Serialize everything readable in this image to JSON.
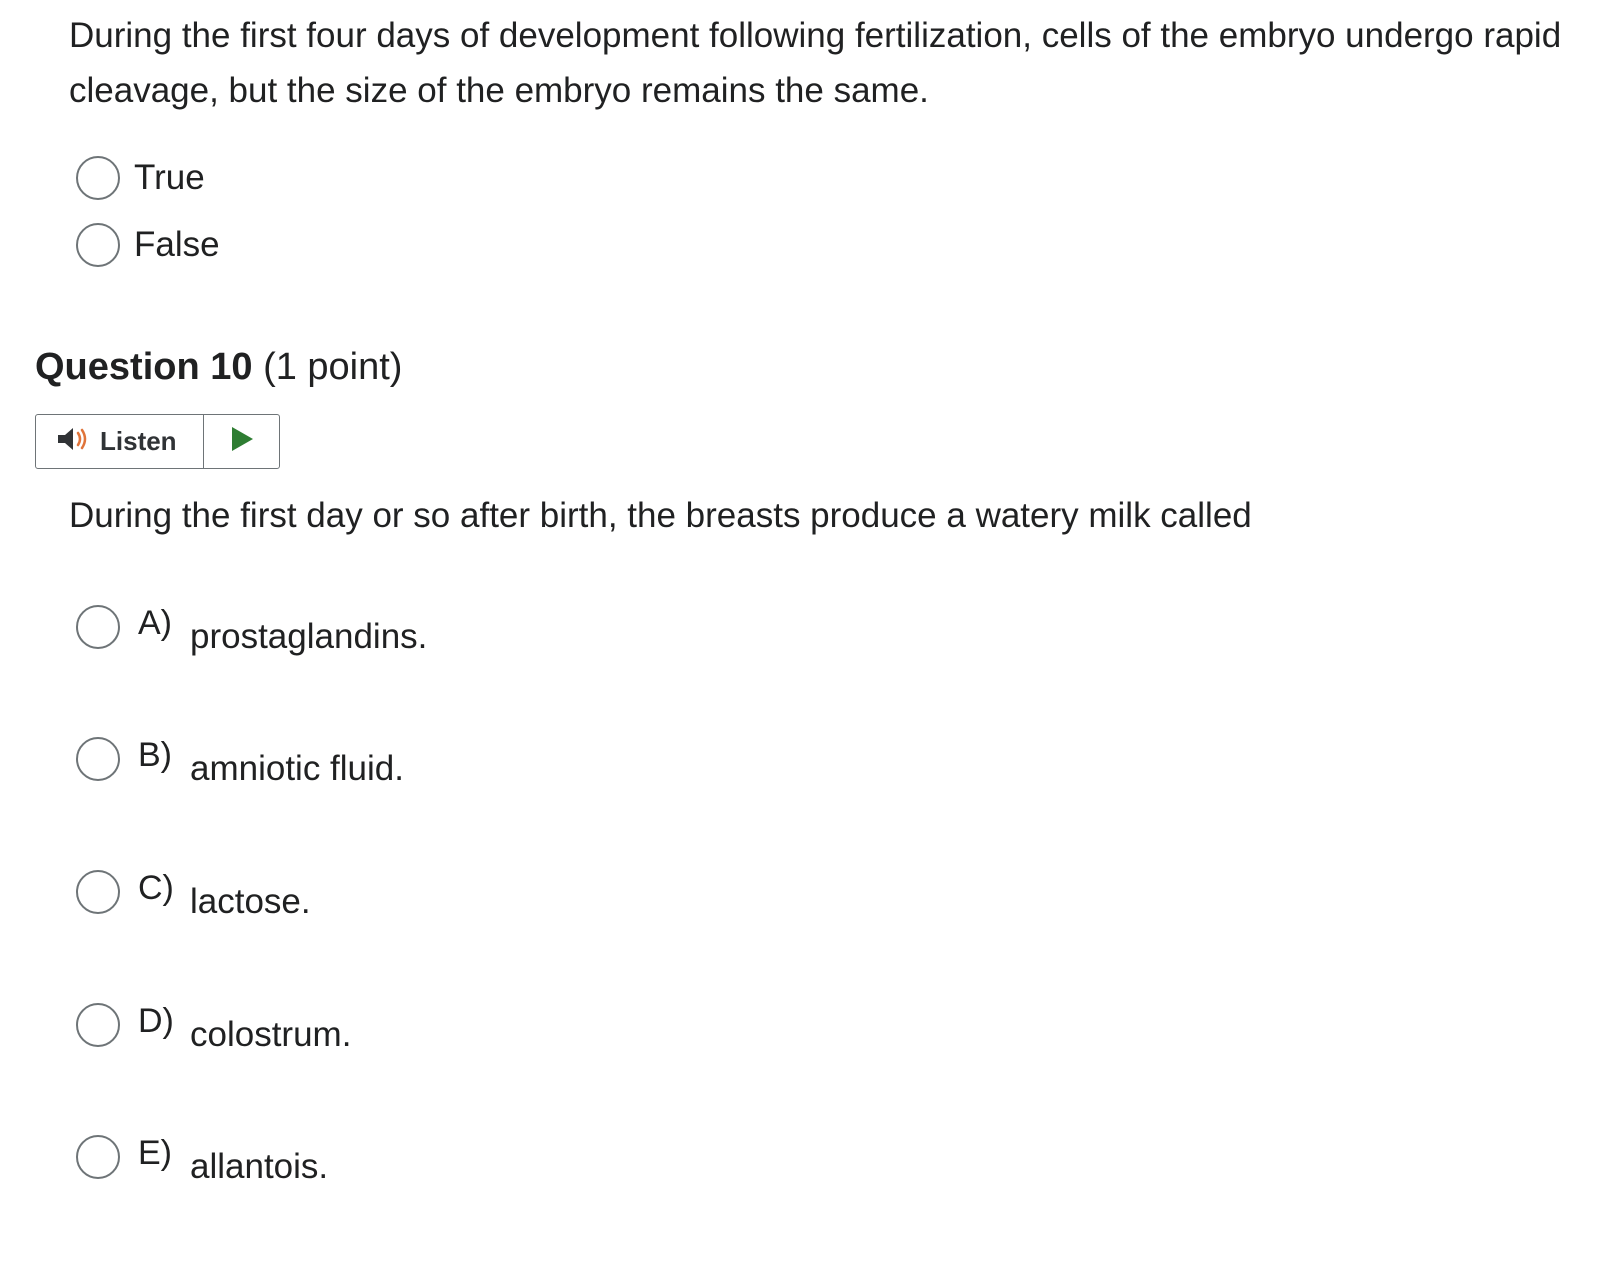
{
  "previous_question": {
    "text": "During the first four days of development following fertilization, cells of the embryo undergo rapid cleavage, but the size of the embryo remains the same.",
    "options": [
      {
        "label": "True"
      },
      {
        "label": "False"
      }
    ]
  },
  "question": {
    "number_label": "Question 10",
    "points_label": "(1 point)",
    "listen_label": "Listen",
    "text": "During the first day or so after birth, the breasts produce a watery milk called",
    "options": [
      {
        "letter": "A)",
        "text": "prostaglandins."
      },
      {
        "letter": "B)",
        "text": "amniotic fluid."
      },
      {
        "letter": "C)",
        "text": "lactose."
      },
      {
        "letter": "D)",
        "text": "colostrum."
      },
      {
        "letter": "E)",
        "text": "allantois."
      }
    ]
  },
  "colors": {
    "speaker_icon": "#303336",
    "speaker_waves": "#e0743a",
    "play_icon": "#2e7d32"
  }
}
